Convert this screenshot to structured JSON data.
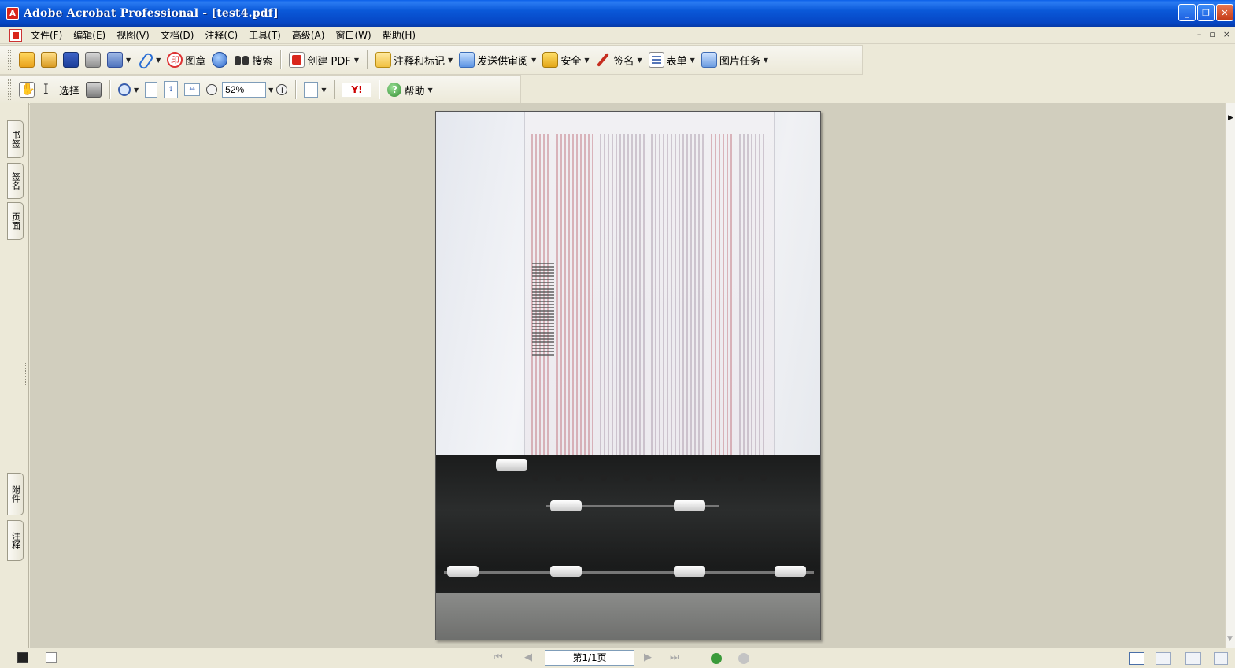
{
  "window": {
    "title": "Adobe Acrobat Professional - [test4.pdf]",
    "app_icon": "acrobat-icon",
    "buttons": [
      "minimize",
      "restore",
      "close"
    ]
  },
  "menubar": {
    "items": [
      {
        "label": "文件(F)"
      },
      {
        "label": "编辑(E)"
      },
      {
        "label": "视图(V)"
      },
      {
        "label": "文档(D)"
      },
      {
        "label": "注释(C)"
      },
      {
        "label": "工具(T)"
      },
      {
        "label": "高级(A)"
      },
      {
        "label": "窗口(W)"
      },
      {
        "label": "帮助(H)"
      }
    ],
    "mdi": {
      "minimize": "–",
      "restore": "▫",
      "close": "×"
    }
  },
  "toolbar1": {
    "stamp_label": "图章",
    "search_label": "搜索",
    "create_pdf_label": "创建 PDF",
    "comment_label": "注释和标记",
    "review_label": "发送供审阅",
    "security_label": "安全",
    "sign_label": "签名",
    "forms_label": "表单",
    "picture_label": "图片任务"
  },
  "toolbar2": {
    "select_label": "选择",
    "zoom_value": "52%",
    "help_label": "帮助",
    "yahoo_label": "Y!"
  },
  "navpanel": {
    "tabs": [
      "书签",
      "签名",
      "页面",
      "附件",
      "注释"
    ]
  },
  "statusbar": {
    "page_display": "第1/1页"
  },
  "colors": {
    "titlebar": "#0a58d8",
    "chrome": "#ece9d8",
    "document_bg": "#d1cebe"
  }
}
